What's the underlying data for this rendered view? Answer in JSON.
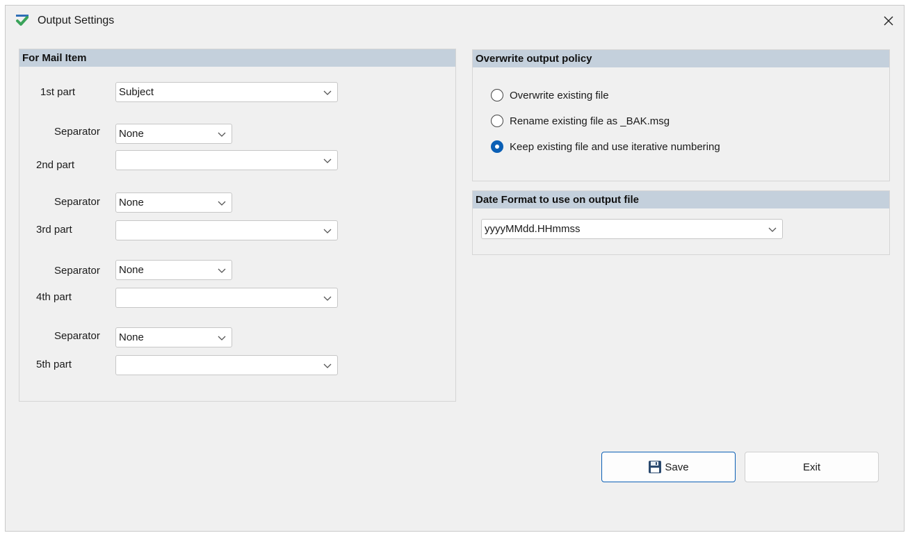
{
  "window": {
    "title": "Output Settings"
  },
  "mail_item": {
    "header": "For Mail Item",
    "parts": [
      {
        "label": "1st part",
        "value": "Subject"
      },
      {
        "label": "2nd part",
        "value": ""
      },
      {
        "label": "3rd part",
        "value": ""
      },
      {
        "label": "4th part",
        "value": ""
      },
      {
        "label": "5th part",
        "value": ""
      }
    ],
    "separators": [
      {
        "label": "Separator",
        "value": "None"
      },
      {
        "label": "Separator",
        "value": "None"
      },
      {
        "label": "Separator",
        "value": "None"
      },
      {
        "label": "Separator",
        "value": "None"
      }
    ]
  },
  "overwrite": {
    "header": "Overwrite output policy",
    "options": [
      {
        "label": "Overwrite existing file",
        "checked": false
      },
      {
        "label": "Rename existing file as _BAK.msg",
        "checked": false
      },
      {
        "label": "Keep existing file and use iterative numbering",
        "checked": true
      }
    ]
  },
  "date_format": {
    "header": "Date Format to use on output file",
    "value": "yyyyMMdd.HHmmss"
  },
  "buttons": {
    "save": "Save",
    "exit": "Exit"
  },
  "colors": {
    "accent": "#0a5fb5",
    "panel_header": "#c4d0dc"
  },
  "icons": {
    "app": "checkmark-app-icon",
    "close": "close-icon",
    "save": "floppy-disk-icon",
    "dropdown": "chevron-down-icon"
  }
}
